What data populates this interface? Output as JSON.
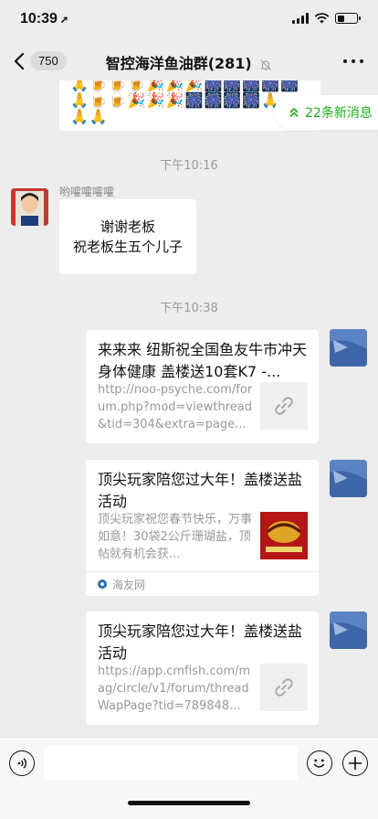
{
  "status_bar": {
    "time": "10:39",
    "location_arrow": "location-arrow-icon",
    "battery_level": 0.35
  },
  "nav": {
    "back_icon": "chevron-left-icon",
    "unread_count": "750",
    "title": "智控海洋鱼油群(281)",
    "mute_icon": "bell-muted-icon",
    "more_icon": "more-icon"
  },
  "new_messages": {
    "label": "22条新消息",
    "icon": "double-chevron-up-icon"
  },
  "emoji_message": {
    "row1": "🙏🍺🍺🍺🎉🎉🎉🎆🎆🎆🎆🎆",
    "row2": "🙏🍺🍺🎉🎉🎉🎆🎆🎆🎆🙏",
    "row3": "🙏🙏"
  },
  "messages": [
    {
      "type": "time",
      "text": "下午10:16"
    },
    {
      "type": "text",
      "sender": "哟嚯嚯嚯嚯",
      "lines": [
        "谢谢老板",
        "祝老板生五个儿子"
      ]
    },
    {
      "type": "time",
      "text": "下午10:38"
    },
    {
      "type": "link",
      "title": "来来来 纽斯祝全国鱼友牛市冲天 身体健康 盖楼送10套K7 -...",
      "desc": "http://noo-psyche.com/forum.php?mod=viewthread&tid=304&extra=page...",
      "thumb": "link-icon"
    },
    {
      "type": "link",
      "title": "顶尖玩家陪您过大年！盖楼送盐活动",
      "desc": "顶尖玩家祝您春节快乐，万事如意！30袋2公斤珊瑚盐，顶帖就有机会获...",
      "thumb": "promo-image",
      "source": "海友网"
    },
    {
      "type": "link",
      "title": "顶尖玩家陪您过大年！盖楼送盐活动",
      "desc": "https://app.cmfish.com/mag/circle/v1/forum/threadWapPage?tid=789848...",
      "thumb": "link-icon"
    }
  ],
  "input_bar": {
    "voice_icon": "voice-icon",
    "placeholder": "",
    "emoji_icon": "emoji-icon",
    "plus_icon": "plus-icon"
  },
  "colors": {
    "accent_green": "#1aad19",
    "background": "#ededed"
  }
}
